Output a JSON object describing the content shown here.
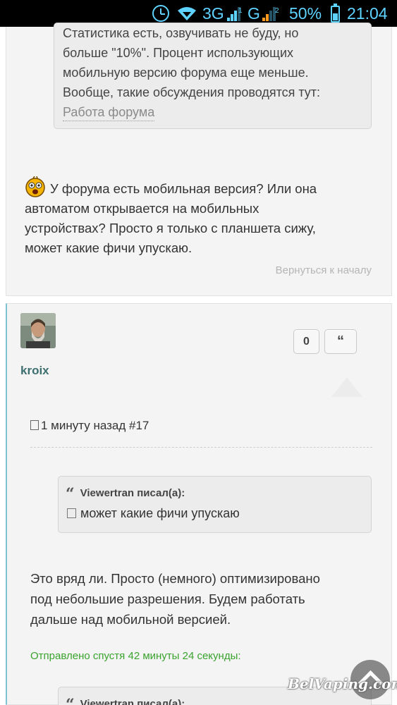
{
  "statusbar": {
    "network1": "3G",
    "network2": "G",
    "sim1_badge": "1",
    "sim2_badge": "2",
    "battery_percent": "50%",
    "battery_level": 0.5,
    "time": "21:04"
  },
  "post1": {
    "quote_lines": [
      "Статистика есть, озвучивать не буду, но",
      "больше \"10%\". Процент использующих",
      "мобильную версию форума еще меньше.",
      "Вообще, такие обсуждения проводятся тут:"
    ],
    "quote_link": "Работа форума",
    "body_lines": [
      "У форума есть мобильная версия? Или она",
      "автоматом открывается на мобильных",
      "устройствах? Просто я только с планшета сижу,",
      "может какие фичи упускаю."
    ],
    "back_to_top": "Вернуться к началу"
  },
  "post2": {
    "username": "kroix",
    "like_count": "0",
    "quote_button": "“",
    "meta": "1 минуту назад #17",
    "quote1": {
      "author": "Viewertran писал(а):",
      "text": "может какие фичи упускаю"
    },
    "body_lines": [
      "Это вряд ли. Просто (немного) оптимизировано",
      "под небольшие разрешения. Будем работать",
      "дальше над мобильной версией."
    ],
    "sent_after": "Отправлено спустя 42 минуты 24 секунды:",
    "quote2": {
      "author": "Viewertran писал(а):"
    }
  },
  "watermark": "BelVaping.com",
  "colors": {
    "accent_link": "#3d6f6f",
    "green_note": "#3aa32e",
    "statusbar_icons": "#5fd3ff",
    "post_border_left": "#7fc3d2"
  },
  "icons": [
    "alarm-clock-icon",
    "wifi-icon",
    "signal-icon",
    "battery-icon",
    "smiley-icon",
    "document-icon",
    "quote-icon",
    "scroll-top-icon"
  ]
}
